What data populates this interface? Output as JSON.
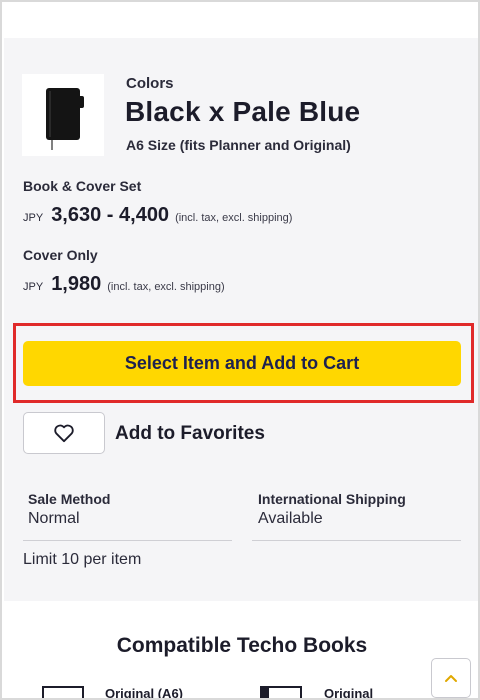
{
  "product": {
    "colors_label": "Colors",
    "color_name": "Black x Pale Blue",
    "size_note": "A6 Size (fits Planner and Original)"
  },
  "pricing": {
    "set_label": "Book & Cover Set",
    "set_currency": "JPY",
    "set_price": "3,630 - 4,400",
    "set_tax_note": "(incl. tax, excl. shipping)",
    "cover_label": "Cover Only",
    "cover_currency": "JPY",
    "cover_price": "1,980",
    "cover_tax_note": "(incl. tax, excl. shipping)"
  },
  "actions": {
    "cart_label": "Select Item and Add to Cart",
    "favorites_label": "Add to Favorites"
  },
  "info": {
    "sale_method_title": "Sale Method",
    "sale_method_value": "Normal",
    "shipping_title": "International Shipping",
    "shipping_value": "Available",
    "limit_text": "Limit 10 per item"
  },
  "compatible": {
    "title": "Compatible Techo Books",
    "items": [
      {
        "label": "Original (A6)"
      },
      {
        "label": "Original"
      }
    ]
  },
  "colors": {
    "cart_button": "#ffd700",
    "highlight_border": "#e02a2a",
    "panel_bg": "#f5f5f7"
  },
  "icons": {
    "favorite": "heart-icon",
    "scroll_top": "chevron-up-icon"
  }
}
